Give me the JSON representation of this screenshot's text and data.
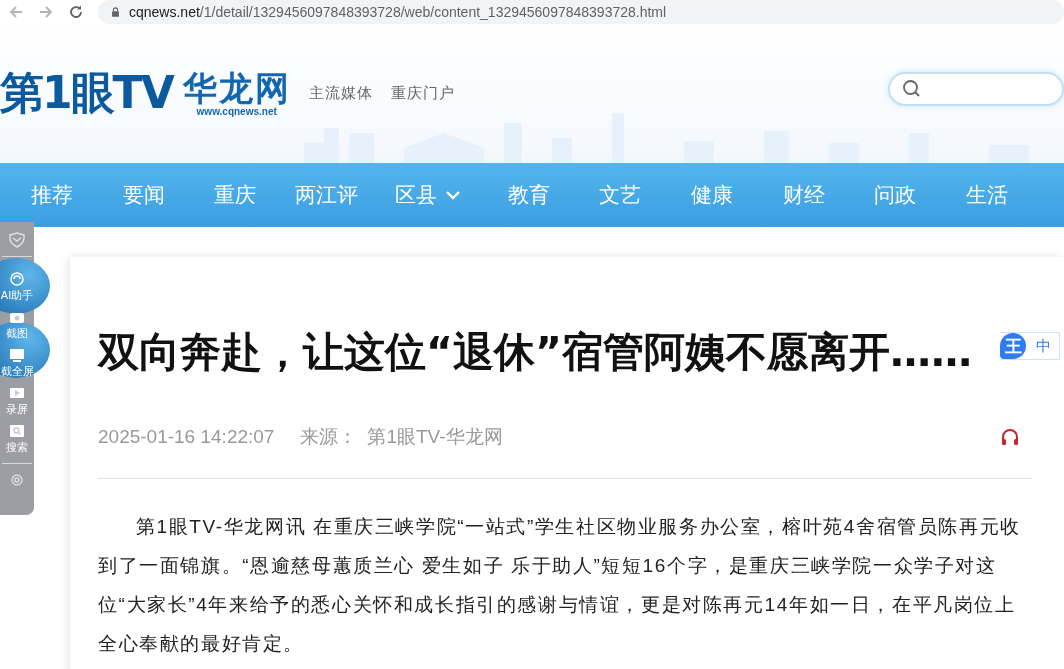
{
  "browser": {
    "url_host": "cqnews.net",
    "url_path": "/1/detail/1329456097848393728/web/content_1329456097848393728.html"
  },
  "header": {
    "logo": "第1眼TV",
    "brand": "华龙网",
    "domain": "www.cqnews.net",
    "slogans": [
      "主流媒体",
      "重庆门户"
    ]
  },
  "nav": [
    {
      "label": "推荐",
      "dropdown": false
    },
    {
      "label": "要闻",
      "dropdown": false
    },
    {
      "label": "重庆",
      "dropdown": false
    },
    {
      "label": "两江评",
      "dropdown": false
    },
    {
      "label": "区县",
      "dropdown": true
    },
    {
      "label": "教育",
      "dropdown": false
    },
    {
      "label": "文艺",
      "dropdown": false
    },
    {
      "label": "健康",
      "dropdown": false
    },
    {
      "label": "财经",
      "dropdown": false
    },
    {
      "label": "问政",
      "dropdown": false
    },
    {
      "label": "生活",
      "dropdown": false
    }
  ],
  "toolbar": [
    {
      "kind": "assistant",
      "label": "AI助手"
    },
    {
      "kind": "screenshot",
      "label": "截图"
    },
    {
      "kind": "fullscreen",
      "label": "截全屏"
    },
    {
      "kind": "record",
      "label": "录屏"
    },
    {
      "kind": "search",
      "label": "搜索"
    }
  ],
  "article": {
    "title": "双向奔赴，让这位“退休”宿管阿姨不愿离开……",
    "date": "2025-01-16 14:22:07",
    "source_label": "来源：",
    "source": "第1眼TV-华龙网",
    "body": "第1眼TV-华龙网讯 在重庆三峡学院“一站式”学生社区物业服务办公室，榕叶苑4舍宿管员陈再元收到了一面锦旗。“恩逾慈母蕙质兰心 爱生如子 乐于助人”短短16个字，是重庆三峡学院一众学子对这位“大家长”4年来给予的悉心关怀和成长指引的感谢与情谊，更是对陈再元14年如一日，在平凡岗位上全心奉献的最好肯定。"
  },
  "translate": {
    "badge": "王",
    "label": "中"
  }
}
